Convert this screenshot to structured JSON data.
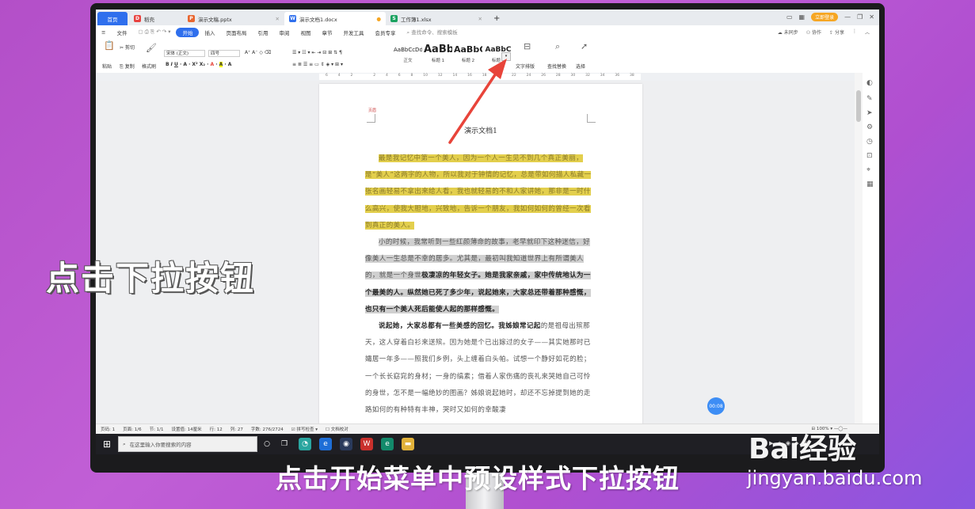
{
  "titlebar": {
    "tabs": [
      {
        "label": "首页",
        "icon": "home"
      },
      {
        "label": "稻壳",
        "icon": "docer-icon",
        "color": "#e8423f"
      },
      {
        "label": "演示文稿.pptx",
        "icon": "ppt-icon",
        "color": "#e8662f"
      },
      {
        "label": "演示文档1.docx",
        "icon": "word-icon",
        "color": "#2f6fed"
      },
      {
        "label": "工作簿1.xlsx",
        "icon": "excel-icon",
        "color": "#1aa260"
      }
    ],
    "login_label": "立即登录"
  },
  "menubar": {
    "items": [
      "文件",
      "开始",
      "插入",
      "页面布局",
      "引用",
      "审阅",
      "视图",
      "章节",
      "开发工具",
      "会员专享"
    ],
    "search_placeholder": "查找命令、搜索模板",
    "right": [
      "未同步",
      "协作",
      "分享"
    ]
  },
  "ribbon": {
    "clipboard": {
      "paste": "粘贴",
      "cut": "剪切",
      "copy": "复制",
      "format_painter": "格式刷"
    },
    "font_name": "宋体 (正文)",
    "font_size": "四号",
    "styles": [
      {
        "preview": "AaBbCcDd",
        "label": "正文"
      },
      {
        "preview": "AaBb",
        "label": "标题 1"
      },
      {
        "preview": "AaBbC",
        "label": "标题 2"
      },
      {
        "preview": "AaBbC",
        "label": "标题 3"
      }
    ],
    "text_layout": "文字排版",
    "find_replace": "查找替换",
    "select": "选择"
  },
  "ruler_marks": [
    "6",
    "4",
    "2",
    "",
    "2",
    "4",
    "6",
    "8",
    "10",
    "12",
    "14",
    "16",
    "18",
    "20",
    "22",
    "24",
    "26",
    "28",
    "30",
    "32",
    "34",
    "36",
    "38"
  ],
  "document": {
    "title": "演示文档1",
    "para1": "最是我记忆中第一个美人，因为一个人一生见不到几个真正美丽，是“美人”这两字的人物，所以我对于钟情的记忆，总是带如何描人私藏一张名画轻易不拿出来给人看，我也就轻易的不和人家讲她，那非是一时什么高兴，使我大胆地，兴致地，告诉一个朋友，我如何如何的曾经一次看到真正的美人。",
    "para2_normal": "小的时候，我常听到一些红颜薄命的故事，老早就印下这种迷信，好像美人一生总是不幸的居多。尤其是，最初叫我知道世界上有所谓美人的，就是一个身世",
    "para2_bold": "极凄凉的年轻女子。她是我家亲戚，家中传统地认为一个最美的人。纵然她已死了多少年，说起她来，大家总还带着那种感慨，也只有一个美人死后能使人起的那样感慨。",
    "para3_bold": "说起她，大家总都有一些美感的回忆。我姊娘常记起",
    "para3_normal": "的是祖母出殡那天，这人穿着白衫来送殡。因为她是个已出嫁过的女子——其实她那时已孀居一年多——照我们乡例，头上缠着白头帕。试想一个静好如花的脸；一个长长窈窕的身材；一身的缟素；借着人家伤痛的丧礼来哭她自己可怜的身世，怎不是一幅绝妙的图画？姊娘说起她时，却还不忘掉提到她的走路如何的有种特有丰神，哭时又如何的幸酸凄"
  },
  "timer": "00:08",
  "statusbar": {
    "items": [
      "页码: 1",
      "页面: 1/6",
      "节: 1/1",
      "设置值: 14厘米",
      "行: 12",
      "列: 27",
      "字数: 276/2724",
      "拼写检查",
      "文档校对"
    ],
    "zoom": "100%"
  },
  "taskbar": {
    "search_placeholder": "在这里输入你要搜索的内容"
  },
  "overlay": {
    "caption": "点击下拉按钮",
    "subtitle": "点击开始菜单中预设样式下拉按钮",
    "watermark_logo": "Bai经验",
    "watermark_url": "jingyan.baidu.com"
  },
  "colors": {
    "accent": "#2f6fed",
    "highlight_yellow": "#e3cf4d",
    "arrow": "#e8443a"
  }
}
